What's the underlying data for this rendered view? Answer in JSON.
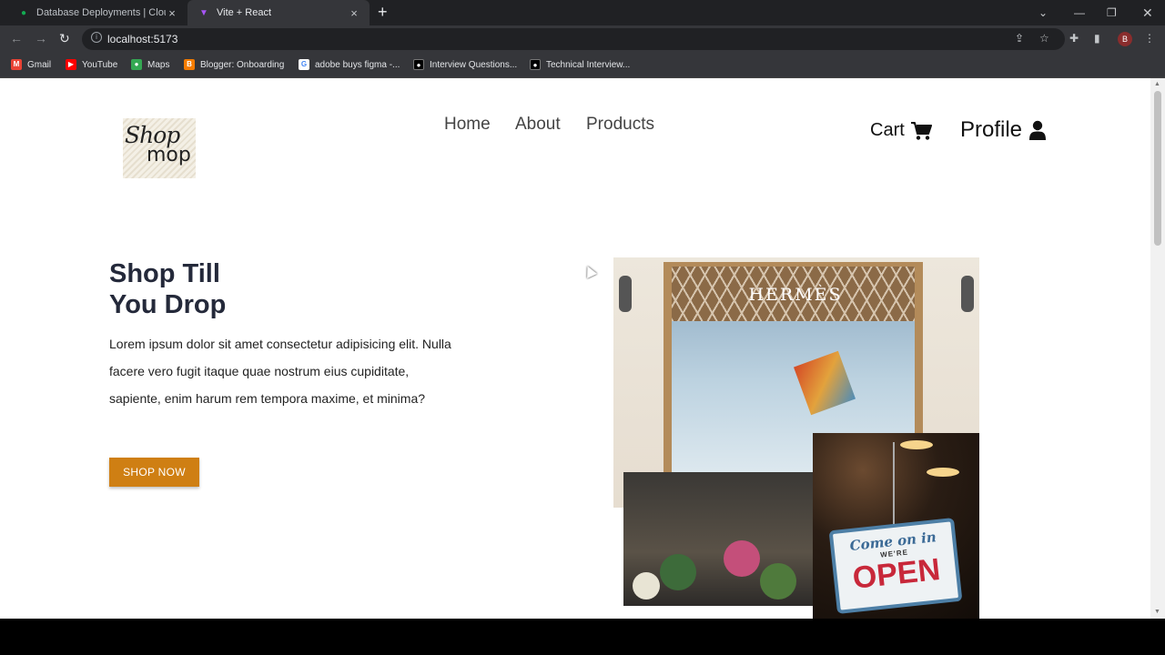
{
  "browser": {
    "tabs": [
      {
        "title": "Database Deployments | Cloud: M",
        "active": false,
        "favicon": "mongodb-leaf-icon"
      },
      {
        "title": "Vite + React",
        "active": true,
        "favicon": "vite-icon"
      }
    ],
    "url": "localhost:5173",
    "profile_initial": "B",
    "bookmarks": [
      {
        "label": "Gmail",
        "icon": "gmail-icon",
        "color": "#ea4335"
      },
      {
        "label": "YouTube",
        "icon": "youtube-icon",
        "color": "#ff0000"
      },
      {
        "label": "Maps",
        "icon": "maps-icon",
        "color": "#34a853"
      },
      {
        "label": "Blogger: Onboarding",
        "icon": "blogger-icon",
        "color": "#f57c00"
      },
      {
        "label": "adobe buys figma -...",
        "icon": "google-icon",
        "color": "#4285f4"
      },
      {
        "label": "Interview Questions...",
        "icon": "medium-icon",
        "color": "#000000"
      },
      {
        "label": "Technical Interview...",
        "icon": "medium-icon",
        "color": "#000000"
      }
    ]
  },
  "site": {
    "logo": {
      "line1": "Shop",
      "line2": "mop"
    },
    "nav": [
      "Home",
      "About",
      "Products"
    ],
    "cart_label": "Cart",
    "profile_label": "Profile",
    "hero": {
      "title_line1": "Shop Till",
      "title_line2": "You Drop",
      "text": "Lorem ipsum dolor sit amet consectetur adipisicing elit. Nulla facere vero fugit itaque quae nostrum eius cupiditate, sapiente, enim harum rem tempora maxime, et minima?",
      "button": "SHOP NOW"
    },
    "images": {
      "storefront_sign": "HERMÈS",
      "open_sign_line1": "Come on in",
      "open_sign_line2": "WE'RE",
      "open_sign_line3": "OPEN"
    },
    "colors": {
      "accent": "#cf7f13",
      "heading": "#24293a"
    }
  }
}
